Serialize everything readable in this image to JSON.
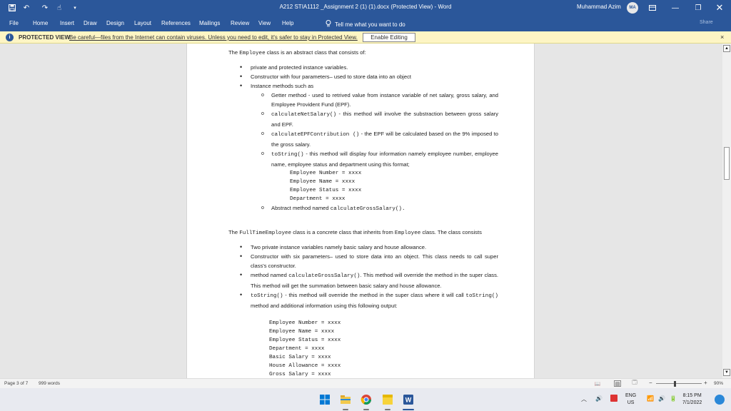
{
  "titlebar": {
    "document_title": "A212 STIA1112 _Assignment 2 (1) (1).docx (Protected View)  -  Word",
    "user_name": "Muhammad Azim",
    "user_initials": "MA",
    "save_icon": "save-icon",
    "undo_icon": "undo-icon",
    "redo_icon": "redo-icon",
    "touch_icon": "touch-mode-icon",
    "customize_icon": "customize-qat-icon",
    "colors": {
      "brand": "#2b579a"
    }
  },
  "ribbon": {
    "tabs": [
      "File",
      "Home",
      "Insert",
      "Draw",
      "Design",
      "Layout",
      "References",
      "Mailings",
      "Review",
      "View",
      "Help"
    ],
    "tell_me": "Tell me what you want to do",
    "share": "Share"
  },
  "protected_view": {
    "label": "PROTECTED VIEW",
    "message": "Be careful—files from the Internet can contain viruses. Unless you need to edit, it's safer to stay in Protected View.",
    "enable_button": "Enable Editing",
    "close": "×",
    "colors": {
      "background": "#fdf5c4"
    }
  },
  "document": {
    "p1_prefix": "The ",
    "p1_code": "Employee",
    "p1_suffix": " class is an abstract class that consists of:",
    "bullets1": [
      "private and protected instance variables.",
      "Constructor  with four parameters– used to store data into an object",
      "Instance methods  such as"
    ],
    "sub1_text": "Getter method - used to retrived value from instance variable of net salary, gross salary, and Employee Provident Fund (EPF).",
    "sub2_code": "calculateNetSalary()",
    "sub2_text": "  -  this  method  will  involve  the  substraction between gross salary and EPF.",
    "sub3_code": "calculateEPFContribution  ()",
    "sub3_text": "  -  the EPF will be calculated based on the 9% imposed to the gross salary.",
    "sub4_code": "toString()",
    "sub4_text": "  -  this method will display four information namely employee number, employee name, employee status and department using this format;",
    "format_lines": [
      "Employee Number = xxxx",
      "Employee Name = xxxx",
      "Employee Status = xxxx",
      "Department = xxxx"
    ],
    "sub5_text": "Abstract method named ",
    "sub5_code": "calculateGrossSalary().",
    "p2_prefix": "The ",
    "p2_code1": "FullTimeEmployee",
    "p2_mid": " class is a concrete class that inherits from ",
    "p2_code2": "Employee",
    "p2_suffix": "  class. The class consists",
    "bullets2_1": "Two private instance variables namely  basic salary and house allowance.",
    "bullets2_2": "Constructor  with six parameters– used to store data into an object. This class needs to call super class's constructor.",
    "bullets2_3_prefix": "method named ",
    "bullets2_3_code": "calculateGrossSalary()",
    "bullets2_3_suffix": ". This method will override the method in the super class. This method will get the summation between basic salary and house allowance.",
    "bullets2_4_code": "toString()",
    "bullets2_4_mid": "  -  this method will override the method in the super class where it will call ",
    "bullets2_4_code2": "toString()",
    "bullets2_4_suffix": " method and additional information using this following output:",
    "output_lines": [
      "Employee Number = xxxx",
      "Employee Name = xxxx",
      "Employee Status = xxxx",
      "Department = xxxx",
      "Basic Salary = xxxx",
      "House Allowance = xxxx",
      "Gross Salary = xxxx"
    ]
  },
  "statusbar": {
    "page": "Page 3 of 7",
    "words": "999 words",
    "zoom": "90%",
    "zoom_minus": "−",
    "zoom_plus": "+",
    "zoom_fraction": 0.4
  },
  "taskbar": {
    "language_top": "ENG",
    "language_bottom": "US",
    "time": "8:15 PM",
    "date": "7/1/2022",
    "apps": [
      "windows-start-icon",
      "file-explorer-icon",
      "chrome-icon",
      "sticky-notes-icon",
      "word-icon"
    ]
  }
}
